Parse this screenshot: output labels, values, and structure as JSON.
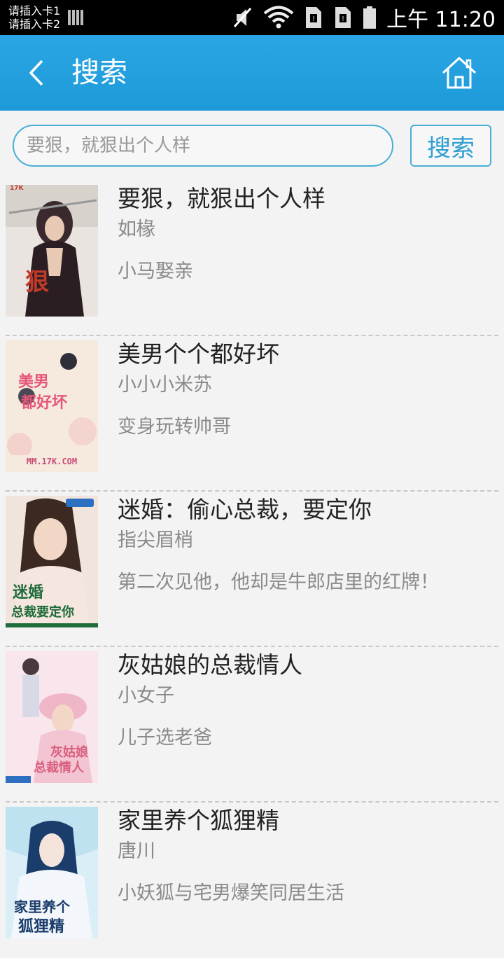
{
  "status_bar": {
    "sim1": "请插入卡1",
    "sim2": "请插入卡2",
    "time": "上午 11:20"
  },
  "app_bar": {
    "title": "搜索",
    "back_icon": "chevron-left-icon",
    "home_icon": "home-icon"
  },
  "search": {
    "placeholder": "要狠，就狠出个人样",
    "value": "",
    "button_label": "搜索"
  },
  "books": [
    {
      "title": "要狠，就狠出个人样",
      "author": "如椽",
      "description": "小马娶亲",
      "cover_colors": [
        "#3a2a2e",
        "#b8a8a0",
        "#c23a2a"
      ]
    },
    {
      "title": "美男个个都好坏",
      "author": "小小小米苏",
      "description": "变身玩转帅哥",
      "cover_colors": [
        "#f6e9de",
        "#f3c7c4",
        "#e5577a"
      ]
    },
    {
      "title": "迷婚：偷心总裁，要定你",
      "author": "指尖眉梢",
      "description": "第二次见他，他却是牛郎店里的红牌！",
      "cover_colors": [
        "#e8d6cc",
        "#3c2a22",
        "#1f6b3a"
      ]
    },
    {
      "title": "灰姑娘的总裁情人",
      "author": "小女子",
      "description": "儿子选老爸",
      "cover_colors": [
        "#f7d8e2",
        "#efb6c8",
        "#d9607f"
      ]
    },
    {
      "title": "家里养个狐狸精",
      "author": "唐川",
      "description": "小妖狐与宅男爆笑同居生活",
      "cover_colors": [
        "#cfe9f4",
        "#f3f7fb",
        "#1b3d6b"
      ]
    }
  ]
}
